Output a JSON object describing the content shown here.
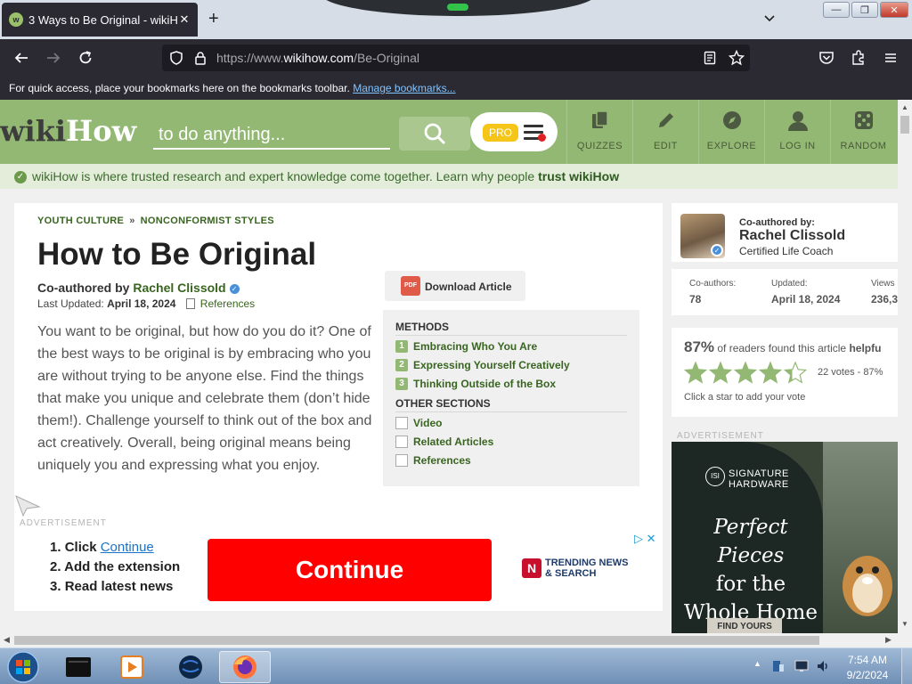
{
  "browser": {
    "tab_title": "3 Ways to Be Original - wikiHow",
    "tab_close": "✕",
    "new_tab": "+",
    "url_prefix": "https://www.",
    "url_domain": "wikihow.com",
    "url_path": "/Be-Original",
    "bookmarks_text": "For quick access, place your bookmarks here on the bookmarks toolbar.",
    "bookmarks_link": "Manage bookmarks..."
  },
  "site": {
    "logo_wiki": "wiki",
    "logo_how": "How",
    "search_placeholder": "to do anything...",
    "pro_label": "PRO",
    "nav": [
      "QUIZZES",
      "EDIT",
      "EXPLORE",
      "LOG IN",
      "RANDOM"
    ],
    "trust_text": "wikiHow is where trusted research and expert knowledge come together. Learn why people ",
    "trust_link": "trust wikiHow"
  },
  "article": {
    "breadcrumb": [
      "YOUTH CULTURE",
      "NONCONFORMIST STYLES"
    ],
    "breadcrumb_sep": "»",
    "title": "How to Be Original",
    "coauthored_prefix": "Co-authored by ",
    "author": "Rachel Clissold",
    "updated_label": "Last Updated: ",
    "updated_date": "April 18, 2024",
    "references_label": "References",
    "intro": "You want to be original, but how do you do it? One of the best ways to be original is by embracing who you are without trying to be anyone else. Find the things that make you unique and celebrate them (don’t hide them!). Challenge yourself to think out of the box and act creatively. Overall, being original means being uniquely you and expressing what you enjoy.",
    "download_label": "Download Article",
    "pdf_icon_label": "PDF"
  },
  "toc": {
    "methods_header": "METHODS",
    "methods": [
      {
        "num": "1",
        "label": "Embracing Who You Are"
      },
      {
        "num": "2",
        "label": "Expressing Yourself Creatively"
      },
      {
        "num": "3",
        "label": "Thinking Outside of the Box"
      }
    ],
    "other_header": "OTHER SECTIONS",
    "other": [
      "Video",
      "Related Articles",
      "References"
    ]
  },
  "ads": {
    "label": "ADVERTISEMENT",
    "steps": [
      "Click ",
      "Add the extension",
      "Read latest news"
    ],
    "step_nums": [
      "1.",
      "2.",
      "3."
    ],
    "continue_link": "Continue",
    "continue_button": "Continue",
    "trending_line1": "TRENDING NEWS",
    "trending_line2": "& SEARCH",
    "trending_logo": "N",
    "side_brand_line1": "SIGNATURE",
    "side_brand_line2": "HARDWARE",
    "side_brand_logo": "ISI",
    "side_headline_1": "Perfect Pieces",
    "side_headline_2": "for the",
    "side_headline_3": "Whole Home",
    "side_cta": "FIND YOURS"
  },
  "sidebar": {
    "coauthored_label": "Co-authored by:",
    "author_name": "Rachel Clissold",
    "author_title": "Certified Life Coach",
    "stats": [
      {
        "label": "Co-authors:",
        "value": "78"
      },
      {
        "label": "Updated:",
        "value": "April 18, 2024"
      },
      {
        "label": "Views",
        "value": "236,3"
      }
    ],
    "helpful_pct": "87%",
    "helpful_text": " of readers found this article ",
    "helpful_word": "helpfu",
    "star_rating": 4.35,
    "votes_text": "22 votes - 87%",
    "vote_prompt": "Click a star to add your vote"
  },
  "taskbar": {
    "time": "7:54 AM",
    "date": "9/2/2024"
  },
  "colors": {
    "wikihow_green": "#93b874",
    "link_green": "#38651f",
    "continue_red": "#ff0000",
    "browser_dark": "#2b2a33"
  }
}
